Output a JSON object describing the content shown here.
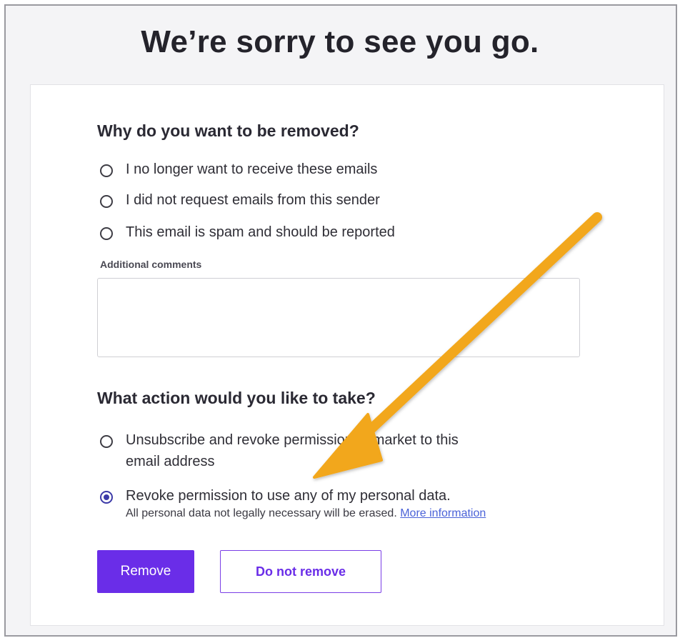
{
  "title": "We’re sorry to see you go.",
  "reason": {
    "heading": "Why do you want to be removed?",
    "options": [
      {
        "label": "I no longer want to receive these emails",
        "selected": false
      },
      {
        "label": "I did not request emails from this sender",
        "selected": false
      },
      {
        "label": "This email is spam and should be reported",
        "selected": false
      }
    ],
    "comments_label": "Additional comments",
    "comments_value": ""
  },
  "action": {
    "heading": "What action would you like to take?",
    "options": [
      {
        "label_line1": "Unsubscribe and revoke permission to market to this",
        "label_line2": "email address",
        "selected": false
      },
      {
        "label": "Revoke permission to use any of my personal data.",
        "note": "All personal data not legally necessary will be erased.",
        "link": "More information",
        "selected": true
      }
    ]
  },
  "buttons": {
    "remove": "Remove",
    "do_not_remove": "Do not remove"
  },
  "colors": {
    "accent": "#6a2de8",
    "radio_selected": "#3c3aa8",
    "link": "#4a62d8",
    "annotation_arrow": "#f2a71b"
  },
  "annotation": {
    "type": "arrow",
    "points_to": "action.options.1"
  }
}
